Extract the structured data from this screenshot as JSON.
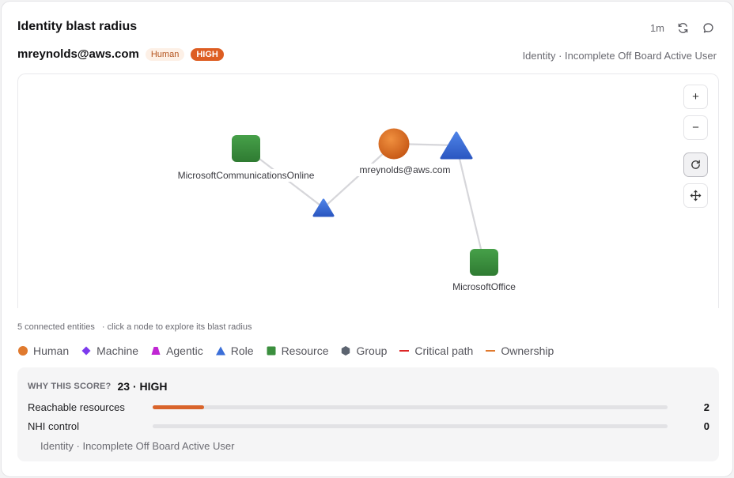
{
  "header": {
    "title": "Identity blast radius",
    "refresh_interval": "1m",
    "icons": [
      "refresh-icon",
      "comment-icon"
    ]
  },
  "identity": {
    "name": "mreynolds@aws.com",
    "type_badge": "Human",
    "severity_badge": "HIGH",
    "description": "Identity · Incomplete Off Board Active User"
  },
  "graph": {
    "nodes": [
      {
        "id": "user",
        "kind": "human",
        "label": "mreynolds@aws.com"
      },
      {
        "id": "role_top",
        "kind": "role",
        "label": ""
      },
      {
        "id": "role_mid",
        "kind": "role",
        "label": ""
      },
      {
        "id": "res_comm",
        "kind": "resource",
        "label": "MicrosoftCommunicationsOnline"
      },
      {
        "id": "res_office",
        "kind": "resource",
        "label": "MicrosoftOffice"
      }
    ],
    "edges": [
      [
        "user",
        "role_top"
      ],
      [
        "user",
        "role_mid"
      ],
      [
        "role_mid",
        "res_comm"
      ],
      [
        "role_top",
        "res_office"
      ]
    ],
    "controls": {
      "zoom_in": "+",
      "zoom_out": "−"
    }
  },
  "hint": {
    "count": "5 connected entities",
    "text": "· click a node to explore its blast radius"
  },
  "legend": [
    {
      "label": "Human",
      "shape": "circle",
      "color": "#e07a2e"
    },
    {
      "label": "Machine",
      "shape": "diamond",
      "color": "#7c3aed"
    },
    {
      "label": "Agentic",
      "shape": "trapezoid",
      "color": "#c026d3"
    },
    {
      "label": "Role",
      "shape": "triangle",
      "color": "#3b6fd8"
    },
    {
      "label": "Resource",
      "shape": "square",
      "color": "#3b8f3e"
    },
    {
      "label": "Group",
      "shape": "hexagon",
      "color": "#5c6470"
    },
    {
      "label": "Critical path",
      "shape": "line",
      "color": "#dc2626"
    },
    {
      "label": "Ownership",
      "shape": "line",
      "color": "#e07a2e"
    }
  ],
  "score": {
    "kicker": "WHY THIS SCORE?",
    "value": "23 · HIGH",
    "metrics": [
      {
        "label": "Reachable resources",
        "value": "2",
        "fraction": 0.1
      },
      {
        "label": "NHI control",
        "value": "0",
        "fraction": 0
      }
    ],
    "footer": "Identity · Incomplete Off Board Active User"
  }
}
